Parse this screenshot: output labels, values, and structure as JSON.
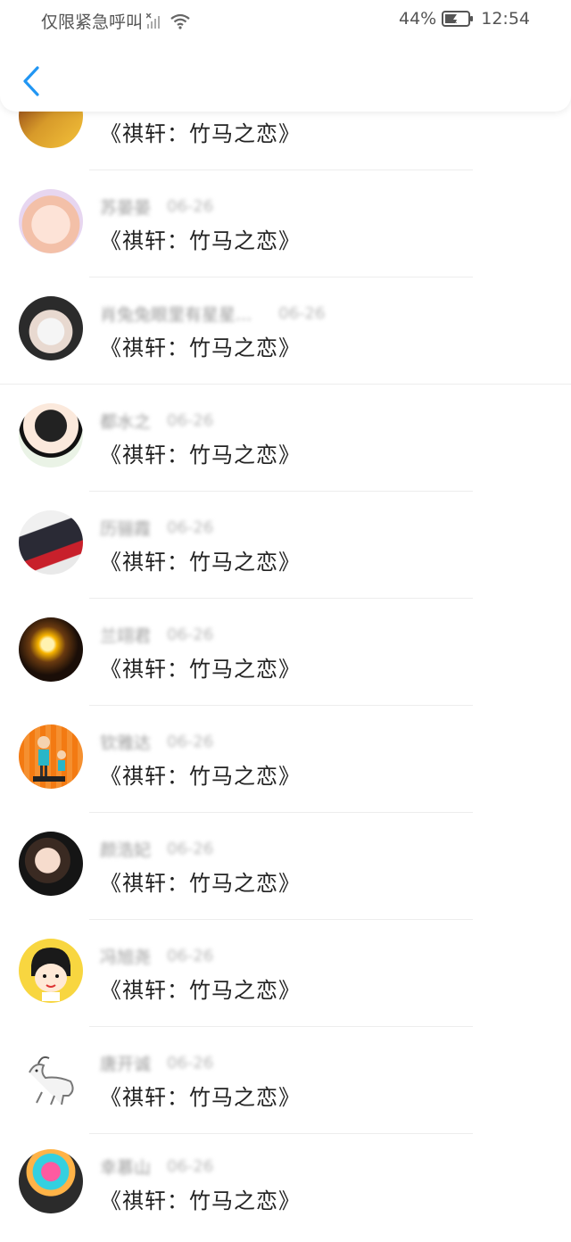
{
  "status_bar": {
    "left_text": "仅限紧急呼叫",
    "battery": "44%",
    "time": "12:54"
  },
  "header": {
    "back_icon": "chevron-left-icon",
    "accent": "#2196f3"
  },
  "list": [
    {
      "name": "",
      "date": "",
      "title": "《祺轩：竹马之恋》"
    },
    {
      "name": "苏晏晏",
      "date": "06-26",
      "title": "《祺轩：竹马之恋》"
    },
    {
      "name": "肖兔兔眼里有星星...",
      "date": "06-26",
      "title": "《祺轩：竹马之恋》"
    },
    {
      "name": "都水之",
      "date": "06-26",
      "title": "《祺轩：竹马之恋》"
    },
    {
      "name": "历骊霞",
      "date": "06-26",
      "title": "《祺轩：竹马之恋》"
    },
    {
      "name": "兰翊君",
      "date": "06-26",
      "title": "《祺轩：竹马之恋》"
    },
    {
      "name": "钦雅达",
      "date": "06-26",
      "title": "《祺轩：竹马之恋》"
    },
    {
      "name": "颜浩妃",
      "date": "06-26",
      "title": "《祺轩：竹马之恋》"
    },
    {
      "name": "冯旭尧",
      "date": "06-26",
      "title": "《祺轩：竹马之恋》"
    },
    {
      "name": "唐开诚",
      "date": "06-26",
      "title": "《祺轩：竹马之恋》"
    },
    {
      "name": "幸慕山",
      "date": "06-26",
      "title": "《祺轩：竹马之恋》"
    }
  ]
}
